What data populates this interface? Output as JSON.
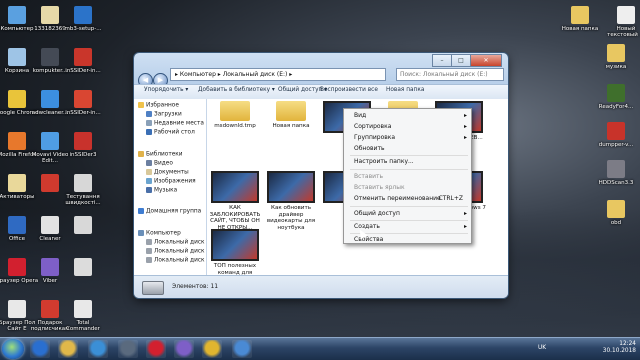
{
  "desktop": {
    "left_icons": [
      {
        "label": "Компьютер",
        "color": "#5aa0e0"
      },
      {
        "label": "133182369",
        "color": "#e6d9a8"
      },
      {
        "label": "mb3-setup-...",
        "color": "#2b73c9"
      },
      {
        "label": "Корзина",
        "color": "#9ec4e6"
      },
      {
        "label": "kompukter...",
        "color": "#444a55"
      },
      {
        "label": "inSSIDer-in...",
        "color": "#c9362b"
      },
      {
        "label": "Google Chrome",
        "color": "#e9c43a"
      },
      {
        "label": "adwcleaner...",
        "color": "#3c8fe0"
      },
      {
        "label": "inSSIDer-in...",
        "color": "#d94632"
      },
      {
        "label": "Mozilla Firefox",
        "color": "#e7782c"
      },
      {
        "label": "Movavi Video Edit...",
        "color": "#4f9de4"
      },
      {
        "label": "inSSIDer3",
        "color": "#c8322c"
      },
      {
        "label": "Активаторы",
        "color": "#e9d89a"
      },
      {
        "label": "",
        "color": "#cf3a2e"
      },
      {
        "label": "Тестування швидкості...",
        "color": "#d7d7d7"
      },
      {
        "label": "Оfficе",
        "color": "#2f6ac2"
      },
      {
        "label": "Сlеаnеr",
        "color": "#e2e2e2"
      },
      {
        "label": "",
        "color": "#d8d8d8"
      },
      {
        "label": "Браузер Opera",
        "color": "#d2202f"
      },
      {
        "label": "Viber",
        "color": "#7e5fc7"
      },
      {
        "label": "",
        "color": "#dcdcdc"
      },
      {
        "label": "Браузер Пол Сайт Е",
        "color": "#e8e8e8"
      },
      {
        "label": "Подарок подписчикам",
        "color": "#d23b2f"
      },
      {
        "label": "Total Commander",
        "color": "#e8e8e8"
      }
    ],
    "right_icons": [
      {
        "label": "Новая папка",
        "color": "#e8c761"
      },
      {
        "label": "Новый текстовый ...",
        "color": "#eeeeee"
      },
      {
        "label": "музика",
        "color": "#e8c761"
      },
      {
        "label": "ReadyFor4...",
        "color": "#3f6f2c"
      },
      {
        "label": "dumpper-v...",
        "color": "#c8332a"
      },
      {
        "label": "HDDScan3.3",
        "color": "#7c7c86"
      },
      {
        "label": "obd",
        "color": "#e8c761"
      }
    ]
  },
  "window": {
    "address_path": "▸ Компьютер ▸ Локальный диск (E:) ▸",
    "search_placeholder": "Поиск: Локальный диск (E:)",
    "caption_min": "–",
    "caption_max": "□",
    "caption_close": "✕",
    "toolbar": [
      "Упорядочить ▾",
      "Добавить в библиотеку ▾",
      "Общий доступ ▾",
      "Воспроизвести все",
      "Новая папка"
    ],
    "nav_pane": [
      {
        "label": "Избранное",
        "color": "#f0c24a",
        "indent": 0
      },
      {
        "label": "Загрузки",
        "color": "#4f80c4",
        "indent": 1
      },
      {
        "label": "Недавние места",
        "color": "#8aa0b8",
        "indent": 1
      },
      {
        "label": "Рабочий стол",
        "color": "#3b6fb5",
        "indent": 1
      },
      {
        "label": "Библиотеки",
        "color": "#e0b24a",
        "indent": 0
      },
      {
        "label": "Видео",
        "color": "#6b7fa0",
        "indent": 1
      },
      {
        "label": "Документы",
        "color": "#d8c89a",
        "indent": 1
      },
      {
        "label": "Изображения",
        "color": "#6aa4cf",
        "indent": 1
      },
      {
        "label": "Музыка",
        "color": "#4a6fa8",
        "indent": 1
      },
      {
        "label": "Домашняя группа",
        "color": "#3f7dd1",
        "indent": 0
      },
      {
        "label": "Компьютер",
        "color": "#6a8fb8",
        "indent": 0
      },
      {
        "label": "Локальный диск",
        "color": "#9aa1ab",
        "indent": 1
      },
      {
        "label": "Локальный диск",
        "color": "#9aa1ab",
        "indent": 1
      },
      {
        "label": "Локальный диск",
        "color": "#9aa1ab",
        "indent": 1
      }
    ],
    "files": [
      {
        "label": "msdownld.tmp",
        "kind": "folder"
      },
      {
        "label": "Новая папка",
        "kind": "folder"
      },
      {
        "label": "",
        "kind": "video"
      },
      {
        "label": "",
        "kind": "folder"
      },
      {
        "label": "...ОВАТ ...ЕТЕВ...",
        "kind": "video"
      },
      {
        "label": "КАК ЗАБЛОКИРОВАТЬ САЙТ, ЧТОБЫ ОН НЕ ОТКРЫ...",
        "kind": "video"
      },
      {
        "label": "Как обновить драйвер видеокарты для ноутбука",
        "kind": "video"
      },
      {
        "label": "",
        "kind": "video"
      },
      {
        "label": "...аддер ...ndows 7",
        "kind": "video"
      },
      {
        "label": "ТОП полезных команд для Windows 7",
        "kind": "video"
      }
    ],
    "status_count": "Элементов: 11"
  },
  "context_menu": {
    "items": [
      {
        "label": "Вид",
        "arrow": "▸",
        "shortcut": "",
        "disabled": false
      },
      {
        "label": "Сортировка",
        "arrow": "▸",
        "shortcut": "",
        "disabled": false
      },
      {
        "label": "Группировка",
        "arrow": "▸",
        "shortcut": "",
        "disabled": false
      },
      {
        "label": "Обновить",
        "arrow": "",
        "shortcut": "",
        "disabled": false
      },
      {
        "label": "Настроить папку...",
        "arrow": "",
        "shortcut": "",
        "disabled": false
      },
      {
        "label": "Вставить",
        "arrow": "",
        "shortcut": "",
        "disabled": true
      },
      {
        "label": "Вставить ярлык",
        "arrow": "",
        "shortcut": "",
        "disabled": true
      },
      {
        "label": "Отменить переименование",
        "arrow": "",
        "shortcut": "CTRL+Z",
        "disabled": false
      },
      {
        "label": "Общий доступ",
        "arrow": "▸",
        "shortcut": "",
        "disabled": false
      },
      {
        "label": "Создать",
        "arrow": "▸",
        "shortcut": "",
        "disabled": false
      },
      {
        "label": "Свойства",
        "arrow": "",
        "shortcut": "",
        "disabled": false
      }
    ]
  },
  "taskbar": {
    "buttons": [
      {
        "name": "ie",
        "color": "#2a6fd0"
      },
      {
        "name": "explorer",
        "color": "#e0b84a"
      },
      {
        "name": "media",
        "color": "#3b8fd6"
      },
      {
        "name": "app",
        "color": "#5a6a7e"
      },
      {
        "name": "opera",
        "color": "#d2202f"
      },
      {
        "name": "viber",
        "color": "#7e5fc7"
      },
      {
        "name": "chrome",
        "color": "#e0b52f"
      },
      {
        "name": "explorer-window",
        "color": "#4a8ad4"
      }
    ],
    "lang": "UK",
    "time": "12:24",
    "date": "30.10.2018"
  }
}
